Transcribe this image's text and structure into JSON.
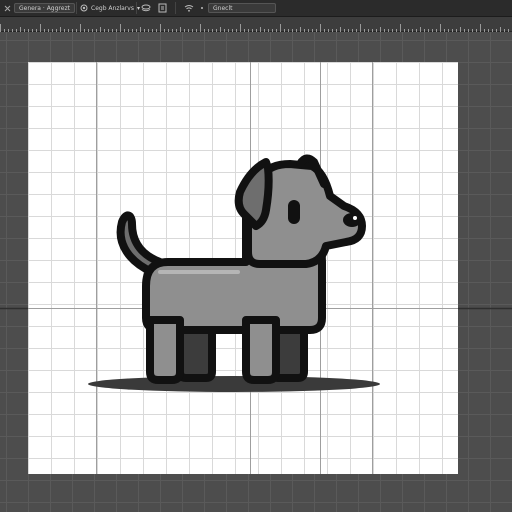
{
  "toolbar": {
    "doc_tab_1": "Genera · Aggrezt",
    "doc_tab_2": "Cegb Anzlarvs",
    "doc_tab_2_chevron": "▾",
    "zoom_field": "Gneclt"
  },
  "canvas": {
    "background": "#4d4d4d",
    "artboard_color": "#ffffff",
    "subject": "dog-illustration",
    "dog_fill": "#8f8f8f",
    "dog_outline": "#111111"
  }
}
